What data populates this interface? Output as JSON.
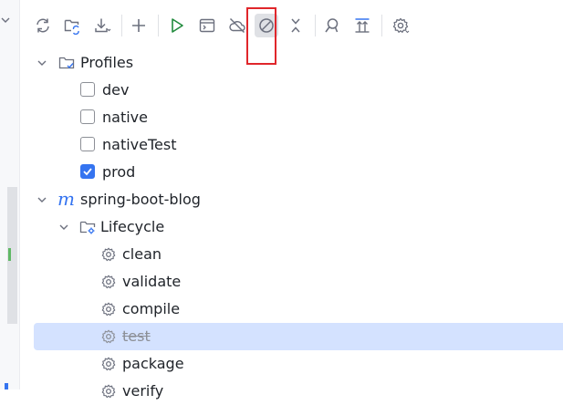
{
  "toolbar": {
    "buttons": [
      {
        "name": "reload-all-maven-projects",
        "icon": "sync-icon"
      },
      {
        "name": "generate-sources",
        "icon": "folder-sync-icon"
      },
      {
        "name": "download-sources",
        "icon": "download-icon"
      },
      {
        "name": "add-maven-project",
        "icon": "plus-icon"
      },
      {
        "name": "run-maven-build",
        "icon": "run-icon"
      },
      {
        "name": "execute-maven-goal",
        "icon": "terminal-window-icon"
      },
      {
        "name": "toggle-offline-mode",
        "icon": "cloud-off-icon"
      },
      {
        "name": "skip-tests",
        "icon": "skip-tests-icon"
      },
      {
        "name": "collapse-all",
        "icon": "collapse-icon"
      },
      {
        "name": "show-dependencies",
        "icon": "dependencies-icon"
      },
      {
        "name": "expand-all",
        "icon": "expand-icon"
      },
      {
        "name": "maven-settings",
        "icon": "gear-icon"
      }
    ]
  },
  "tree": {
    "profiles": {
      "label": "Profiles",
      "items": [
        {
          "label": "dev",
          "checked": false
        },
        {
          "label": "native",
          "checked": false
        },
        {
          "label": "nativeTest",
          "checked": false
        },
        {
          "label": "prod",
          "checked": true
        }
      ]
    },
    "project": {
      "label": "spring-boot-blog",
      "lifecycle": {
        "label": "Lifecycle",
        "phases": [
          {
            "label": "clean",
            "skipped": false
          },
          {
            "label": "validate",
            "skipped": false
          },
          {
            "label": "compile",
            "skipped": false
          },
          {
            "label": "test",
            "skipped": true
          },
          {
            "label": "package",
            "skipped": false
          },
          {
            "label": "verify",
            "skipped": false
          }
        ]
      }
    }
  },
  "colors": {
    "accent": "#3574f0",
    "selection": "#d4e2ff",
    "run_green": "#208a3c",
    "highlight_red": "#e0262b"
  }
}
